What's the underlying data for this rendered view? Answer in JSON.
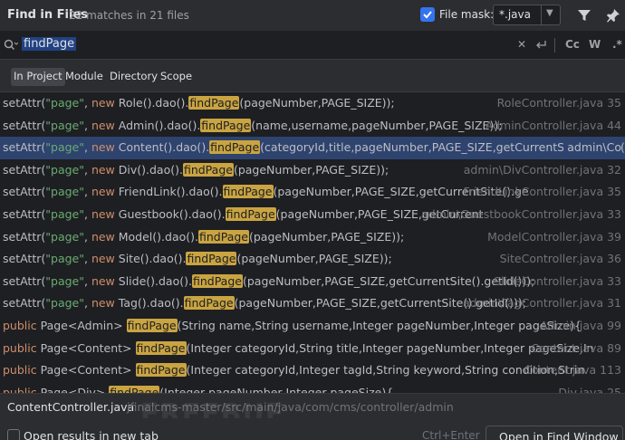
{
  "header": {
    "title": "Find in Files",
    "match_count": "22 matches in 21 files",
    "file_mask_label": "File mask:",
    "file_mask_value": "*.java",
    "file_mask_checked": true
  },
  "search": {
    "query": "findPage",
    "tools": {
      "case": "Cc",
      "words": "W",
      "regex": ".*"
    }
  },
  "scopes": [
    {
      "label": "In Project",
      "active": true
    },
    {
      "label": "Module",
      "active": false
    },
    {
      "label": "Directory",
      "active": false
    },
    {
      "label": "Scope",
      "active": false
    }
  ],
  "results": [
    {
      "parts": [
        [
          "",
          "setAttr("
        ],
        [
          "str",
          "\"page\""
        ],
        [
          "",
          ", "
        ],
        [
          "kw",
          "new"
        ],
        [
          "",
          " Role().dao()."
        ],
        [
          "hl",
          "findPage"
        ],
        [
          "",
          "(pageNumber,PAGE_SIZE));"
        ]
      ],
      "loc": "RoleController.java 35",
      "selected": false
    },
    {
      "parts": [
        [
          "",
          "setAttr("
        ],
        [
          "str",
          "\"page\""
        ],
        [
          "",
          ", "
        ],
        [
          "kw",
          "new"
        ],
        [
          "",
          " Admin().dao()."
        ],
        [
          "hl",
          "findPage"
        ],
        [
          "",
          "(name,username,pageNumber,PAGE_SIZE));"
        ]
      ],
      "loc": "AdminController.java 44",
      "selected": false
    },
    {
      "parts": [
        [
          "",
          "setAttr("
        ],
        [
          "str",
          "\"page\""
        ],
        [
          "",
          ", "
        ],
        [
          "kw",
          "new"
        ],
        [
          "",
          " Content().dao()."
        ],
        [
          "hl",
          "findPage"
        ],
        [
          "",
          "(categoryId,title,pageNumber,PAGE_SIZE,getCurrentSite().getId()));"
        ]
      ],
      "loc": "admin\\Co",
      "selected": true
    },
    {
      "parts": [
        [
          "",
          "setAttr("
        ],
        [
          "str",
          "\"page\""
        ],
        [
          "",
          ", "
        ],
        [
          "kw",
          "new"
        ],
        [
          "",
          " Div().dao()."
        ],
        [
          "hl",
          "findPage"
        ],
        [
          "",
          "(pageNumber,PAGE_SIZE));"
        ]
      ],
      "loc": "admin\\DivController.java 32",
      "selected": false
    },
    {
      "parts": [
        [
          "",
          "setAttr("
        ],
        [
          "str",
          "\"page\""
        ],
        [
          "",
          ", "
        ],
        [
          "kw",
          "new"
        ],
        [
          "",
          " FriendLink().dao()."
        ],
        [
          "hl",
          "findPage"
        ],
        [
          "",
          "(pageNumber,PAGE_SIZE,getCurrentSite().ge"
        ]
      ],
      "loc": "FriendLinkController.java 35",
      "selected": false
    },
    {
      "parts": [
        [
          "",
          "setAttr("
        ],
        [
          "str",
          "\"page\""
        ],
        [
          "",
          ", "
        ],
        [
          "kw",
          "new"
        ],
        [
          "",
          " Guestbook().dao()."
        ],
        [
          "hl",
          "findPage"
        ],
        [
          "",
          "(pageNumber,PAGE_SIZE,getCurrent"
        ]
      ],
      "loc": "admin\\GuestbookController.java 33",
      "selected": false
    },
    {
      "parts": [
        [
          "",
          "setAttr("
        ],
        [
          "str",
          "\"page\""
        ],
        [
          "",
          ", "
        ],
        [
          "kw",
          "new"
        ],
        [
          "",
          " Model().dao()."
        ],
        [
          "hl",
          "findPage"
        ],
        [
          "",
          "(pageNumber,PAGE_SIZE));"
        ]
      ],
      "loc": "ModelController.java 39",
      "selected": false
    },
    {
      "parts": [
        [
          "",
          "setAttr("
        ],
        [
          "str",
          "\"page\""
        ],
        [
          "",
          ", "
        ],
        [
          "kw",
          "new"
        ],
        [
          "",
          " Site().dao()."
        ],
        [
          "hl",
          "findPage"
        ],
        [
          "",
          "(pageNumber,PAGE_SIZE));"
        ]
      ],
      "loc": "SiteController.java 36",
      "selected": false
    },
    {
      "parts": [
        [
          "",
          "setAttr("
        ],
        [
          "str",
          "\"page\""
        ],
        [
          "",
          ", "
        ],
        [
          "kw",
          "new"
        ],
        [
          "",
          " Slide().dao()."
        ],
        [
          "hl",
          "findPage"
        ],
        [
          "",
          "(pageNumber,PAGE_SIZE,getCurrentSite().getId()));"
        ]
      ],
      "loc": "SlideController.java 33",
      "selected": false
    },
    {
      "parts": [
        [
          "",
          "setAttr("
        ],
        [
          "str",
          "\"page\""
        ],
        [
          "",
          ", "
        ],
        [
          "kw",
          "new"
        ],
        [
          "",
          " Tag().dao()."
        ],
        [
          "hl",
          "findPage"
        ],
        [
          "",
          "(pageNumber,PAGE_SIZE,getCurrentSite().getId()));"
        ]
      ],
      "loc": "admin\\TagController.java 31",
      "selected": false
    },
    {
      "parts": [
        [
          "kw",
          "public"
        ],
        [
          "",
          " Page<Admin> "
        ],
        [
          "hl",
          "findPage"
        ],
        [
          "",
          "(String name,String username,Integer pageNumber,Integer pageSize){"
        ]
      ],
      "loc": "Admin.java 99",
      "selected": false
    },
    {
      "parts": [
        [
          "kw",
          "public"
        ],
        [
          "",
          " Page<Content> "
        ],
        [
          "hl",
          "findPage"
        ],
        [
          "",
          "(Integer categoryId,String title,Integer pageNumber,Integer pageSize,In"
        ]
      ],
      "loc": "Content.java 89",
      "selected": false
    },
    {
      "parts": [
        [
          "kw",
          "public"
        ],
        [
          "",
          " Page<Content> "
        ],
        [
          "hl",
          "findPage"
        ],
        [
          "",
          "(Integer categoryId,Integer tagId,String keyword,String condition,Strin"
        ]
      ],
      "loc": "Content.java 113",
      "selected": false
    },
    {
      "parts": [
        [
          "kw",
          "public"
        ],
        [
          "",
          " Page<Div> "
        ],
        [
          "hl",
          "findPage"
        ],
        [
          "",
          "(Integer pageNumber,Integer pageSize){"
        ]
      ],
      "loc": "Div.java 25",
      "selected": false
    }
  ],
  "path_bar": {
    "file": "ContentController.java",
    "dir": "jfinalcms-master/src/main/java/com/cms/controller/admin"
  },
  "footer": {
    "open_in_new_tab": "Open results in new tab",
    "shortcut": "Ctrl+Enter",
    "open_button": "Open in Find Window"
  },
  "watermark": "FREEBUF",
  "colors": {
    "accent": "#3574f0",
    "highlight": "#c9a441",
    "selection": "#2e436e"
  }
}
